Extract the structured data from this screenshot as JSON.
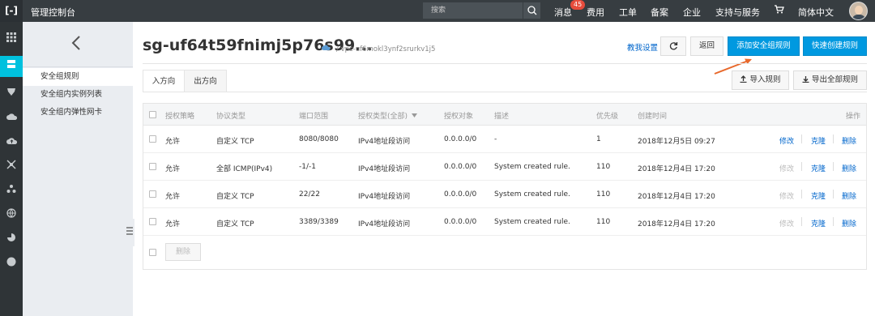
{
  "topbar": {
    "logo": "[-]",
    "title": "管理控制台",
    "search_placeholder": "搜索",
    "nav": [
      "消息",
      "费用",
      "工单",
      "备案",
      "企业",
      "支持与服务",
      "简体中文"
    ],
    "message_badge": "45"
  },
  "rail_icons": [
    "grid-icon",
    "server-icon",
    "security-icon",
    "cloud-icon",
    "cloud-upload-icon",
    "network-icon",
    "nodes-icon",
    "globe-icon",
    "pie-icon",
    "circle-icon"
  ],
  "sidebar": {
    "items": [
      {
        "label": "安全组规则",
        "active": true
      },
      {
        "label": "安全组内实例列表",
        "active": false
      },
      {
        "label": "安全组内弹性网卡",
        "active": false
      }
    ]
  },
  "header": {
    "title": "sg-uf64t59fnimj5p76s99...",
    "vpc": "/ vpc-uf6mokl3ynf2srurkv1j5",
    "help_link": "教我设置",
    "back_button": "返回",
    "add_rule_button": "添加安全组规则",
    "quick_create_button": "快速创建规则"
  },
  "tabs": [
    "入方向",
    "出方向"
  ],
  "actions": {
    "import": "导入规则",
    "export": "导出全部规则"
  },
  "table": {
    "columns": [
      "授权策略",
      "协议类型",
      "端口范围",
      "授权类型(全部)",
      "授权对象",
      "描述",
      "优先级",
      "创建时间",
      "操作"
    ],
    "rows": [
      {
        "policy": "允许",
        "protocol": "自定义 TCP",
        "port": "8080/8080",
        "auth_type": "IPv4地址段访问",
        "target": "0.0.0.0/0",
        "desc": "-",
        "priority": "1",
        "time": "2018年12月5日 09:27",
        "ops": [
          "修改",
          "克隆",
          "删除"
        ],
        "edit_enabled": true
      },
      {
        "policy": "允许",
        "protocol": "全部 ICMP(IPv4)",
        "port": "-1/-1",
        "auth_type": "IPv4地址段访问",
        "target": "0.0.0.0/0",
        "desc": "System created rule.",
        "priority": "110",
        "time": "2018年12月4日 17:20",
        "ops": [
          "修改",
          "克隆",
          "删除"
        ],
        "edit_enabled": false
      },
      {
        "policy": "允许",
        "protocol": "自定义 TCP",
        "port": "22/22",
        "auth_type": "IPv4地址段访问",
        "target": "0.0.0.0/0",
        "desc": "System created rule.",
        "priority": "110",
        "time": "2018年12月4日 17:20",
        "ops": [
          "修改",
          "克隆",
          "删除"
        ],
        "edit_enabled": false
      },
      {
        "policy": "允许",
        "protocol": "自定义 TCP",
        "port": "3389/3389",
        "auth_type": "IPv4地址段访问",
        "target": "0.0.0.0/0",
        "desc": "System created rule.",
        "priority": "110",
        "time": "2018年12月4日 17:20",
        "ops": [
          "修改",
          "克隆",
          "删除"
        ],
        "edit_enabled": false
      }
    ],
    "bulk_delete": "删除"
  },
  "colors": {
    "topbar": "#373d41",
    "accent": "#00c1de",
    "primary_button": "#0099e0",
    "link": "#0066cc",
    "arrow": "#e8692c"
  }
}
